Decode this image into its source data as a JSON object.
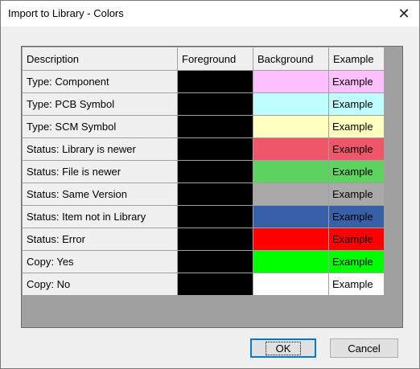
{
  "window": {
    "title": "Import to Library - Colors",
    "close_glyph": "✕"
  },
  "table": {
    "headers": [
      "Description",
      "Foreground",
      "Background",
      "Example"
    ],
    "rows": [
      {
        "description": "Type: Component",
        "foreground": "#000000",
        "background": "#ffc0ff",
        "example": "Example"
      },
      {
        "description": "Type: PCB Symbol",
        "foreground": "#000000",
        "background": "#c0ffff",
        "example": "Example"
      },
      {
        "description": "Type: SCM Symbol",
        "foreground": "#000000",
        "background": "#ffffc0",
        "example": "Example"
      },
      {
        "description": "Status: Library is newer",
        "foreground": "#000000",
        "background": "#f0566a",
        "example": "Example"
      },
      {
        "description": "Status: File is newer",
        "foreground": "#000000",
        "background": "#5fd35f",
        "example": "Example"
      },
      {
        "description": "Status: Same Version",
        "foreground": "#000000",
        "background": "#a9a9a9",
        "example": "Example"
      },
      {
        "description": "Status: Item not in Library",
        "foreground": "#000000",
        "background": "#3860a8",
        "example": "Example"
      },
      {
        "description": "Status: Error",
        "foreground": "#000000",
        "background": "#ff0000",
        "example": "Example"
      },
      {
        "description": "Copy: Yes",
        "foreground": "#000000",
        "background": "#00ff00",
        "example": "Example"
      },
      {
        "description": "Copy: No",
        "foreground": "#000000",
        "background": "#ffffff",
        "example": "Example"
      }
    ]
  },
  "buttons": {
    "ok_label": "OK",
    "cancel_label": "Cancel"
  }
}
